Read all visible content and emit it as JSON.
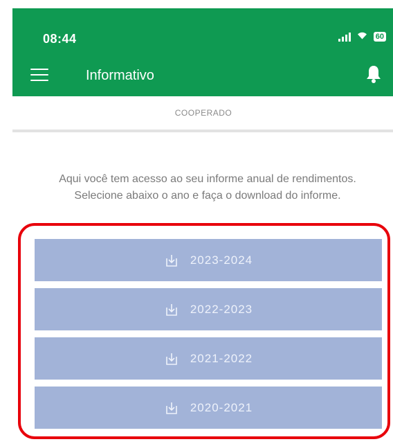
{
  "status_bar": {
    "time": "08:44",
    "battery": "60"
  },
  "app_bar": {
    "title": "Informativo",
    "icons": [
      "menu-icon",
      "bell-icon"
    ]
  },
  "tab": {
    "label": "COOPERADO"
  },
  "description": "Aqui você tem acesso ao seu informe anual de rendimentos. Selecione abaixo o ano e faça o download do informe.",
  "downloads": [
    {
      "label": "2023-2024",
      "icon": "download-icon"
    },
    {
      "label": "2022-2023",
      "icon": "download-icon"
    },
    {
      "label": "2021-2022",
      "icon": "download-icon"
    },
    {
      "label": "2020-2021",
      "icon": "download-icon"
    }
  ],
  "colors": {
    "header": "#0f9a52",
    "button": "#a2b3d8",
    "highlight": "#e8000b"
  }
}
